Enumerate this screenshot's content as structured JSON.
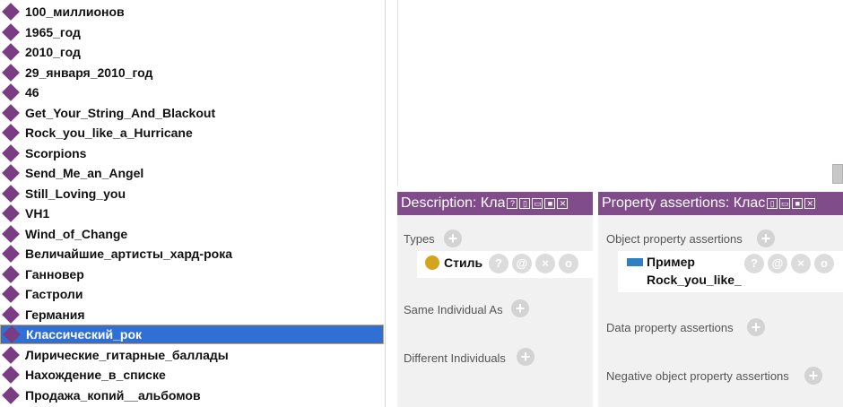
{
  "individuals": {
    "items": [
      "100_миллионов",
      "1965_год",
      "2010_год",
      "29_января_2010_год",
      "46",
      "Get_Your_String_And_Blackout",
      "Rock_you_like_a_Hurricane",
      "Scorpions",
      "Send_Me_an_Angel",
      "Still_Loving_you",
      "VH1",
      "Wind_of_Change",
      "Величайшие_артисты_хард-рока",
      "Ганновер",
      "Гастроли",
      "Германия",
      "Классический_рок",
      "Лирические_гитарные_баллады",
      "Нахождение_в_списке",
      "Продажа_копий__альбомов"
    ],
    "selected_index": 16,
    "icon": "diamond-icon",
    "icon_color": "#7a3c83",
    "selected_color": "#2f6fd6"
  },
  "description_panel": {
    "title": "Description: Кла",
    "controls": [
      "?",
      "▯",
      "▭",
      "■",
      "✕"
    ],
    "types_label": "Types",
    "type_entry": "Стиль",
    "type_icon_color": "#d4a51c",
    "same_label": "Same Individual As",
    "different_label": "Different Individuals"
  },
  "property_panel": {
    "title": "Property assertions: Клас",
    "controls": [
      "▯",
      "▭",
      "■",
      "✕"
    ],
    "object_label": "Object property assertions",
    "object_entry_property": "Пример",
    "object_entry_value": "Rock_you_like_",
    "object_icon_color": "#2f7fc4",
    "data_label": "Data property assertions",
    "negative_label": "Negative object property assertions"
  },
  "header_color": "#804c8a"
}
